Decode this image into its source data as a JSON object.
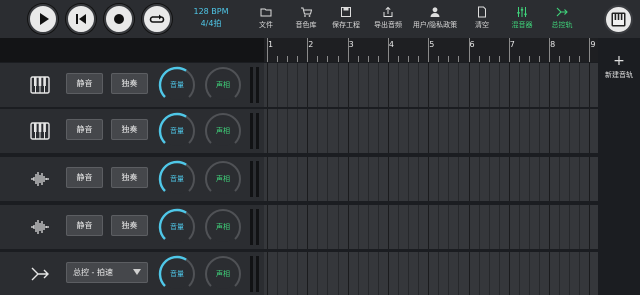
{
  "toolbar": {
    "bpm": "128 BPM",
    "time_signature": "4/4拍",
    "transport": [
      {
        "icon": "play-icon"
      },
      {
        "icon": "skip-back-icon"
      },
      {
        "icon": "record-icon"
      },
      {
        "icon": "loop-icon"
      }
    ],
    "tools": [
      {
        "label": "文件",
        "icon": "folder-icon"
      },
      {
        "label": "音色库",
        "icon": "cart-icon"
      },
      {
        "label": "保存工程",
        "icon": "save-icon"
      },
      {
        "label": "导出音频",
        "icon": "export-icon"
      },
      {
        "label": "用户/隐私政策",
        "icon": "user-icon"
      },
      {
        "label": "清空",
        "icon": "file-icon"
      },
      {
        "label": "混音器",
        "icon": "mixer-icon",
        "color": "#3fd37a"
      },
      {
        "label": "总控轨",
        "icon": "master-track-icon",
        "color": "#3fd37a"
      }
    ],
    "piano_icon": "piano-keys-icon"
  },
  "ruler": {
    "bars": [
      "1",
      "2",
      "3",
      "4",
      "5",
      "6",
      "7",
      "8",
      "9"
    ]
  },
  "right_panel": {
    "new_track_label": "新建音轨",
    "plus_icon": "plus-icon"
  },
  "tracks": [
    {
      "icon": "piano-icon",
      "mute": "静音",
      "solo": "独奏",
      "volume_label": "音量",
      "pan_label": "声相",
      "volume_level": 0.62
    },
    {
      "icon": "piano-icon",
      "mute": "静音",
      "solo": "独奏",
      "volume_label": "音量",
      "pan_label": "声相",
      "volume_level": 0.62
    },
    {
      "icon": "waveform-icon",
      "mute": "静音",
      "solo": "独奏",
      "volume_label": "音量",
      "pan_label": "声相",
      "volume_level": 0.62
    },
    {
      "icon": "waveform-icon",
      "mute": "静音",
      "solo": "独奏",
      "volume_label": "音量",
      "pan_label": "声相",
      "volume_level": 0.62
    },
    {
      "icon": "master-track-icon",
      "master_select": "总控 - 拍速",
      "volume_label": "音量",
      "pan_label": "声相",
      "volume_level": 0.62
    }
  ],
  "colors": {
    "accent_blue": "#4fc7e8",
    "accent_green": "#3fd37a"
  }
}
